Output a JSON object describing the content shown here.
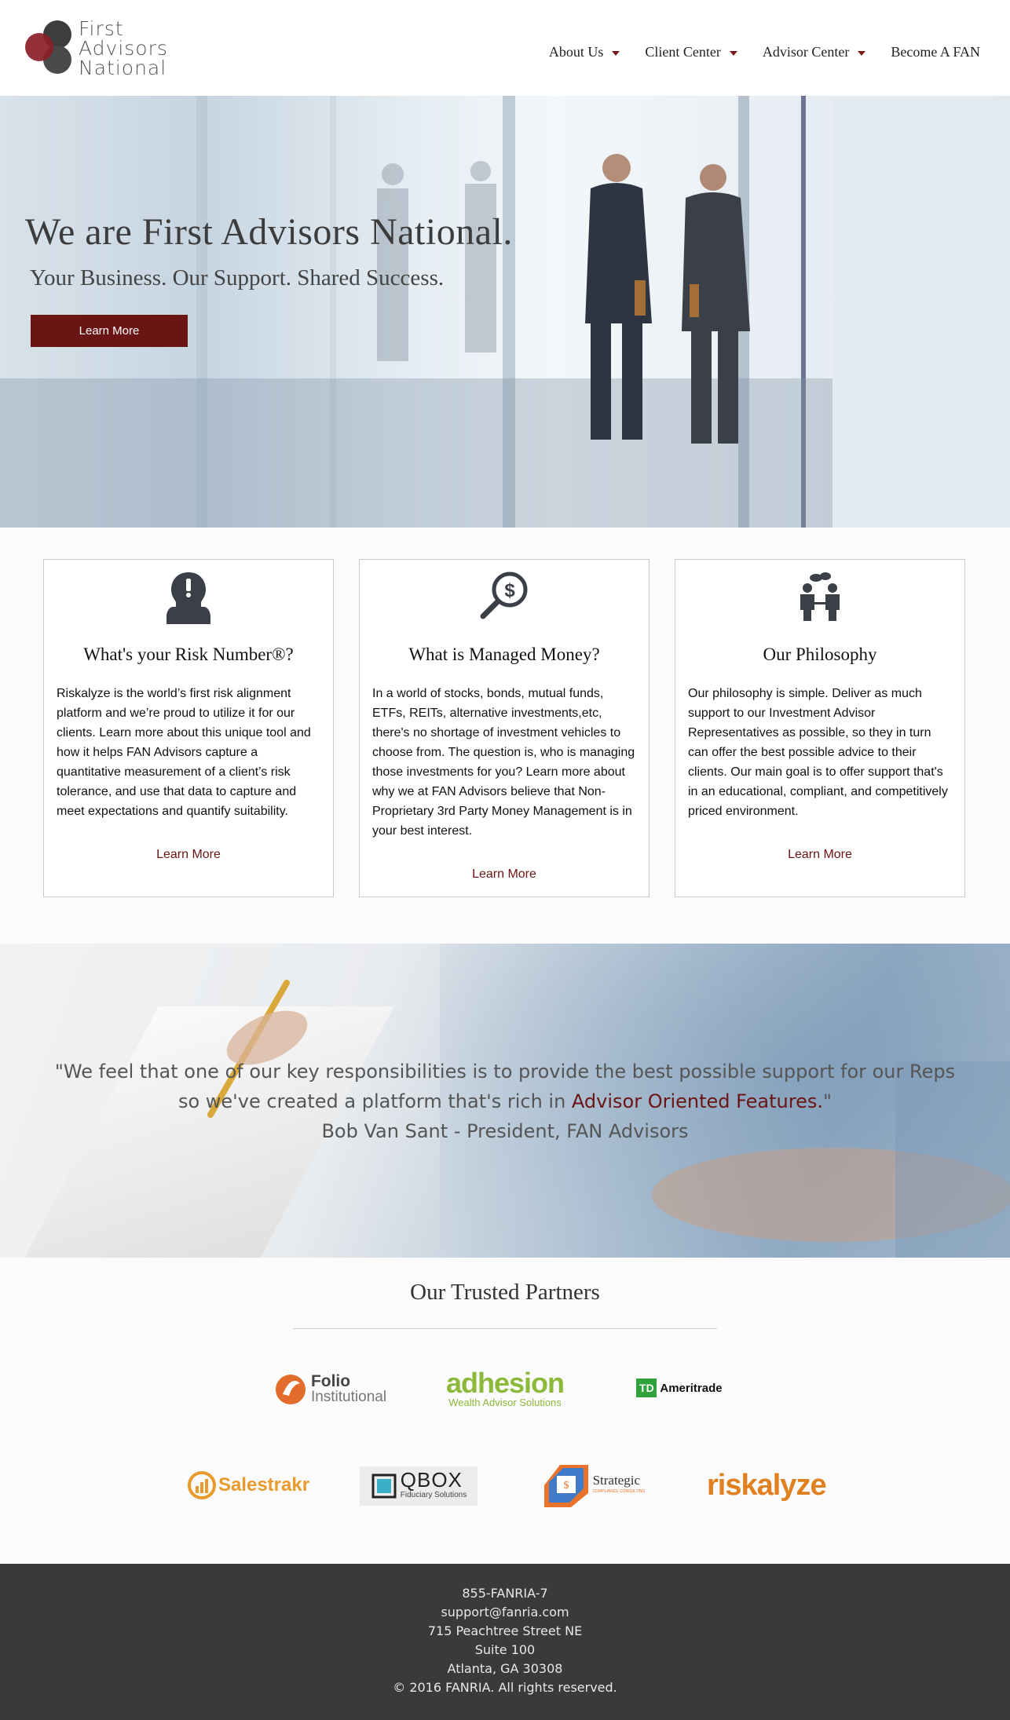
{
  "header": {
    "logo": {
      "line1": "First",
      "line2": "Advisors",
      "line3": "National"
    },
    "nav": [
      {
        "label": "About Us",
        "dropdown": true
      },
      {
        "label": "Client Center",
        "dropdown": true
      },
      {
        "label": "Advisor Center",
        "dropdown": true
      },
      {
        "label": "Become A FAN",
        "dropdown": false
      }
    ]
  },
  "hero": {
    "title": "We are First Advisors National.",
    "subtitle": "Your Business. Our Support. Shared Success.",
    "cta": "Learn More"
  },
  "cards": [
    {
      "icon": "person-exclamation-icon",
      "title": "What's your Risk Number®?",
      "body": "Riskalyze is the world’s first risk alignment platform and we’re proud to utilize it for our clients. Learn more about this unique tool and how it helps FAN Advisors capture a quantitative measurement of a client’s risk tolerance, and use that data to capture and meet expectations and quantify suitability.",
      "link": "Learn More"
    },
    {
      "icon": "magnifier-dollar-icon",
      "title": "What is Managed Money?",
      "body": "In a world of stocks, bonds, mutual funds, ETFs, REITs, alternative investments,etc, there's no shortage of investment vehicles to choose from. The question is, who is managing those investments for you? Learn more about why we at FAN Advisors believe that Non-Proprietary 3rd Party Money Management is in your best interest.",
      "link": "Learn More"
    },
    {
      "icon": "meeting-people-icon",
      "title": "Our Philosophy",
      "body": "Our philosophy is simple. Deliver as much support to our Investment Advisor Representatives as possible, so they in turn can offer the best possible advice to their clients. Our main goal is to offer support that's in an educational, compliant, and competitively priced environment.",
      "link": "Learn More"
    }
  ],
  "quote": {
    "text_before": "\"We feel that one of our key responsibilities is to provide the best possible support for our Reps so we've created a platform that's rich in ",
    "accent": "Advisor Oriented Features.",
    "text_after": "\"",
    "attribution": "Bob Van Sant - President, FAN Advisors"
  },
  "partners": {
    "title": "Our Trusted Partners",
    "logos": [
      {
        "name": "Folio",
        "sub": "Institutional"
      },
      {
        "name": "adhesion",
        "sub": "Wealth Advisor Solutions"
      },
      {
        "name": "Ameritrade",
        "mark": "TD"
      },
      {
        "name": "Salestrakr"
      },
      {
        "name": "QBOX",
        "sub": "Fiduciary Solutions"
      },
      {
        "name": "Strategic",
        "sub": "COMPLIANCE CONSULTING"
      },
      {
        "name": "riskalyze"
      }
    ]
  },
  "footer": {
    "phone": "855-FANRIA-7",
    "email": "support@fanria.com",
    "street": "715 Peachtree Street NE",
    "suite": "Suite 100",
    "city": "Atlanta, GA 30308",
    "copyright": "© 2016 FANRIA. All rights reserved."
  },
  "colors": {
    "accent": "#6b1414",
    "footer_bg": "#3a3a3a"
  }
}
